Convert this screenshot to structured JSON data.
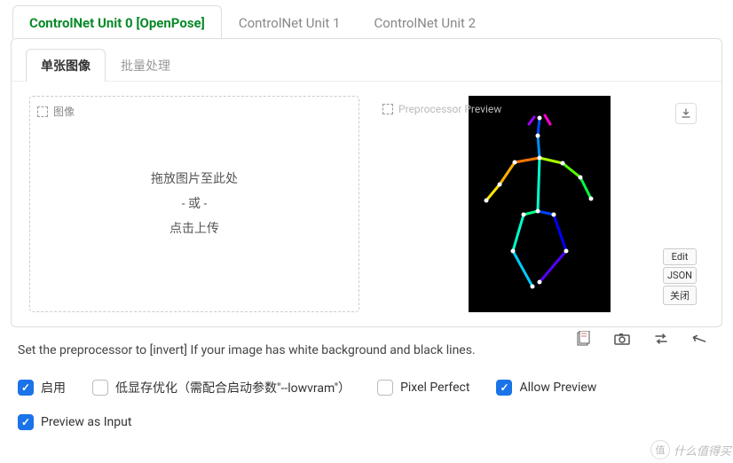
{
  "tabs": {
    "t0": "ControlNet Unit 0 [OpenPose]",
    "t1": "ControlNet Unit 1",
    "t2": "ControlNet Unit 2"
  },
  "innerTabs": {
    "i0": "单张图像",
    "i1": "批量处理"
  },
  "drop": {
    "label": "图像",
    "line1": "拖放图片至此处",
    "line2": "- 或 -",
    "line3": "点击上传"
  },
  "preview": {
    "label": "Preprocessor Preview",
    "edit": "Edit",
    "json": "JSON",
    "close": "关闭"
  },
  "hint": "Set the preprocessor to [invert] If your image has white background and black lines.",
  "checks": {
    "enable": "启用",
    "lowvram": "低显存优化（需配合启动参数\"--lowvram\"）",
    "pixel": "Pixel Perfect",
    "allow": "Allow Preview",
    "pai": "Preview as Input"
  },
  "watermark": {
    "icon": "值",
    "text": "什么值得买"
  }
}
